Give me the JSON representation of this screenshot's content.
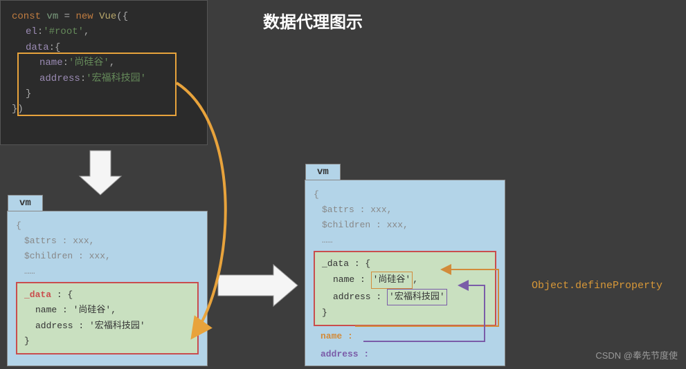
{
  "title": "数据代理图示",
  "code": {
    "l1_const": "const",
    "l1_var": "vm",
    "l1_eq": "=",
    "l1_new": "new",
    "l1_class": "Vue",
    "l1_open": "({",
    "l2_el": "el",
    "l2_elval": "'#root'",
    "l3_data": "data",
    "l3_open": ":{",
    "l4_name": "name",
    "l4_nameval": "'尚硅谷'",
    "l5_addr": "address",
    "l5_addrval": "'宏福科技园'",
    "l6_close": "}",
    "l7_close": "})"
  },
  "vm_left": {
    "tab": "vm",
    "open": "{",
    "attrs": "$attrs : xxx,",
    "children": "$children : xxx,",
    "dots": "……",
    "data_key": "_data",
    "data_open": " : {",
    "name_line": "name : '尚硅谷',",
    "addr_line": "address : '宏福科技园'",
    "data_close": "}",
    "close": "}"
  },
  "vm_right": {
    "tab": "vm",
    "open": "{",
    "attrs": "$attrs : xxx,",
    "children": "$children : xxx,",
    "dots": "……",
    "data_key": "_data",
    "data_open": " : {",
    "name_k": "name :",
    "name_v": "'尚硅谷'",
    "name_c": ",",
    "addr_k": "address :",
    "addr_v": "'宏福科技园'",
    "data_close": "}",
    "ext_name": "name :",
    "ext_addr": "address :",
    "close": "}"
  },
  "define": {
    "obj": "Object",
    "dot": ".",
    "mtd": "defineProperty"
  },
  "watermark": "CSDN @奉先节度使"
}
